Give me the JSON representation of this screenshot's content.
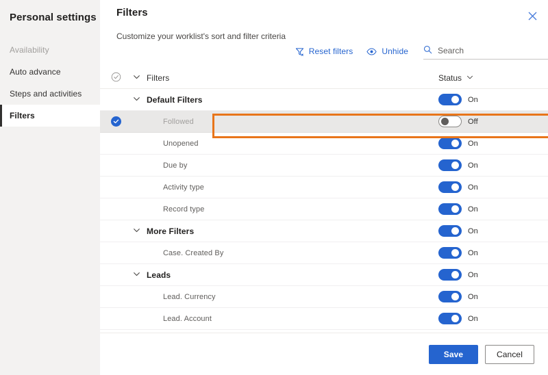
{
  "sidebar": {
    "title": "Personal settings",
    "items": [
      {
        "label": "Availability",
        "state": "disabled"
      },
      {
        "label": "Auto advance",
        "state": "normal"
      },
      {
        "label": "Steps and activities",
        "state": "normal"
      },
      {
        "label": "Filters",
        "state": "selected"
      }
    ]
  },
  "panel": {
    "title": "Filters",
    "subtitle": "Customize your worklist's sort and filter criteria",
    "close_icon": "close-icon"
  },
  "commandbar": {
    "reset_filters": {
      "label": "Reset filters",
      "icon": "filter-reset-icon"
    },
    "unhide": {
      "label": "Unhide",
      "icon": "eye-icon"
    },
    "search": {
      "placeholder": "Search",
      "value": "",
      "icon": "search-icon"
    }
  },
  "list": {
    "header": {
      "select_icon": "circle-check-icon",
      "chevron_icon": "chevron-down-icon",
      "name_column": "Filters",
      "status_column": "Status",
      "status_chevron_icon": "chevron-down-icon"
    },
    "rows": [
      {
        "label": "Default Filters",
        "type": "group",
        "status": "On",
        "toggle": "on",
        "selected": false
      },
      {
        "label": "Followed",
        "type": "child",
        "status": "Off",
        "toggle": "off",
        "selected": true
      },
      {
        "label": "Unopened",
        "type": "child",
        "status": "On",
        "toggle": "on",
        "selected": false
      },
      {
        "label": "Due by",
        "type": "child",
        "status": "On",
        "toggle": "on",
        "selected": false
      },
      {
        "label": "Activity type",
        "type": "child",
        "status": "On",
        "toggle": "on",
        "selected": false
      },
      {
        "label": "Record type",
        "type": "child",
        "status": "On",
        "toggle": "on",
        "selected": false
      },
      {
        "label": "More Filters",
        "type": "group",
        "status": "On",
        "toggle": "on",
        "selected": false
      },
      {
        "label": "Case. Created By",
        "type": "child",
        "status": "On",
        "toggle": "on",
        "selected": false
      },
      {
        "label": "Leads",
        "type": "group",
        "status": "On",
        "toggle": "on",
        "selected": false
      },
      {
        "label": "Lead. Currency",
        "type": "child",
        "status": "On",
        "toggle": "on",
        "selected": false
      },
      {
        "label": "Lead. Account",
        "type": "child",
        "status": "On",
        "toggle": "on",
        "selected": false
      }
    ]
  },
  "footer": {
    "save_label": "Save",
    "cancel_label": "Cancel"
  },
  "colors": {
    "accent": "#2564cf",
    "annotation": "#e8751a",
    "sidebar_bg": "#f3f2f1",
    "selected_row_bg": "#e9e8e7"
  }
}
